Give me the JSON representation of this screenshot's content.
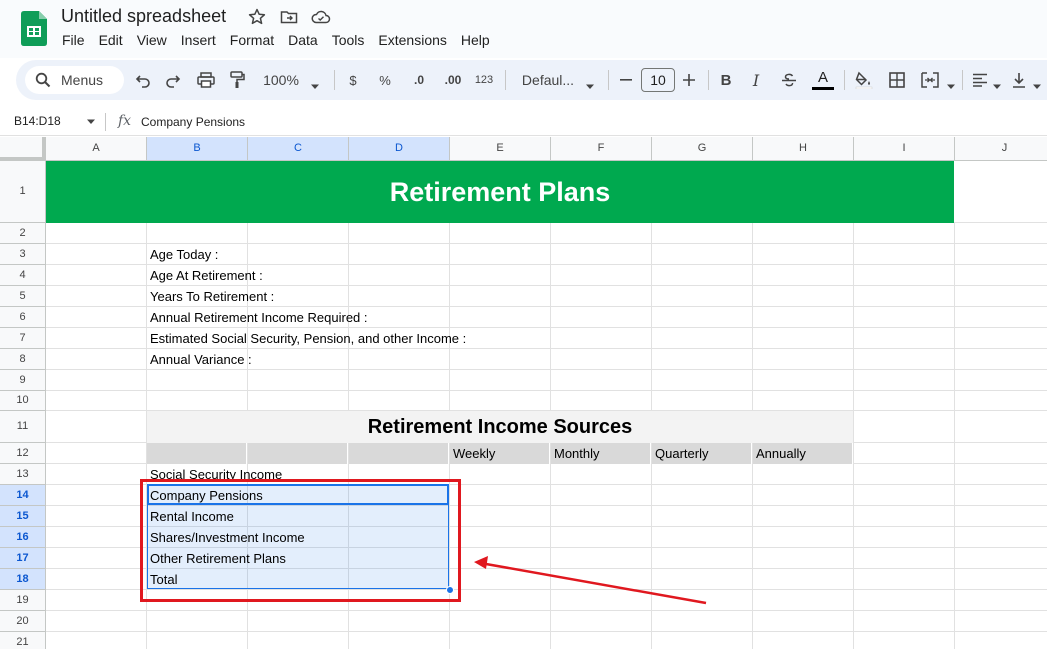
{
  "app": {
    "doc_title": "Untitled spreadsheet",
    "menus": [
      "File",
      "Edit",
      "View",
      "Insert",
      "Format",
      "Data",
      "Tools",
      "Extensions",
      "Help"
    ]
  },
  "toolbar": {
    "search_label": "Menus",
    "zoom": "100%",
    "currency": "$",
    "percent": "%",
    "decrease_decimal": ".0",
    "increase_decimal": ".00",
    "number_format": "123",
    "font": "Defaul...",
    "font_size": "10",
    "bold": "B",
    "italic": "I",
    "text_color_letter": "A"
  },
  "formula_bar": {
    "name_box": "B14:D18",
    "fx": "fx",
    "content": "Company Pensions"
  },
  "grid": {
    "columns": [
      "A",
      "B",
      "C",
      "D",
      "E",
      "F",
      "G",
      "H",
      "I",
      "J"
    ],
    "selected_columns": [
      "B",
      "C",
      "D"
    ],
    "rows": [
      "1",
      "2",
      "3",
      "4",
      "5",
      "6",
      "7",
      "8",
      "9",
      "10",
      "11",
      "12",
      "13",
      "14",
      "15",
      "16",
      "17",
      "18",
      "19",
      "20",
      "21"
    ],
    "selected_rows": [
      "14",
      "15",
      "16",
      "17",
      "18"
    ],
    "banner_title": "Retirement Plans",
    "labels": [
      "Age Today :",
      "Age At Retirement :",
      "Years To Retirement :",
      "Annual Retirement Income Required :",
      "Estimated Social Security, Pension, and other Income :",
      "Annual Variance :"
    ],
    "income_header": "Retirement Income Sources",
    "periods": [
      "Weekly",
      "Monthly",
      "Quarterly",
      "Annually"
    ],
    "income_rows": [
      "Social Security Income",
      "Company Pensions",
      "Rental Income",
      "Shares/Investment  Income",
      "Other Retirement Plans",
      "Total"
    ]
  },
  "colors": {
    "banner": "#00a94f",
    "selection": "#1a73e8",
    "annotation": "#e0181f"
  }
}
